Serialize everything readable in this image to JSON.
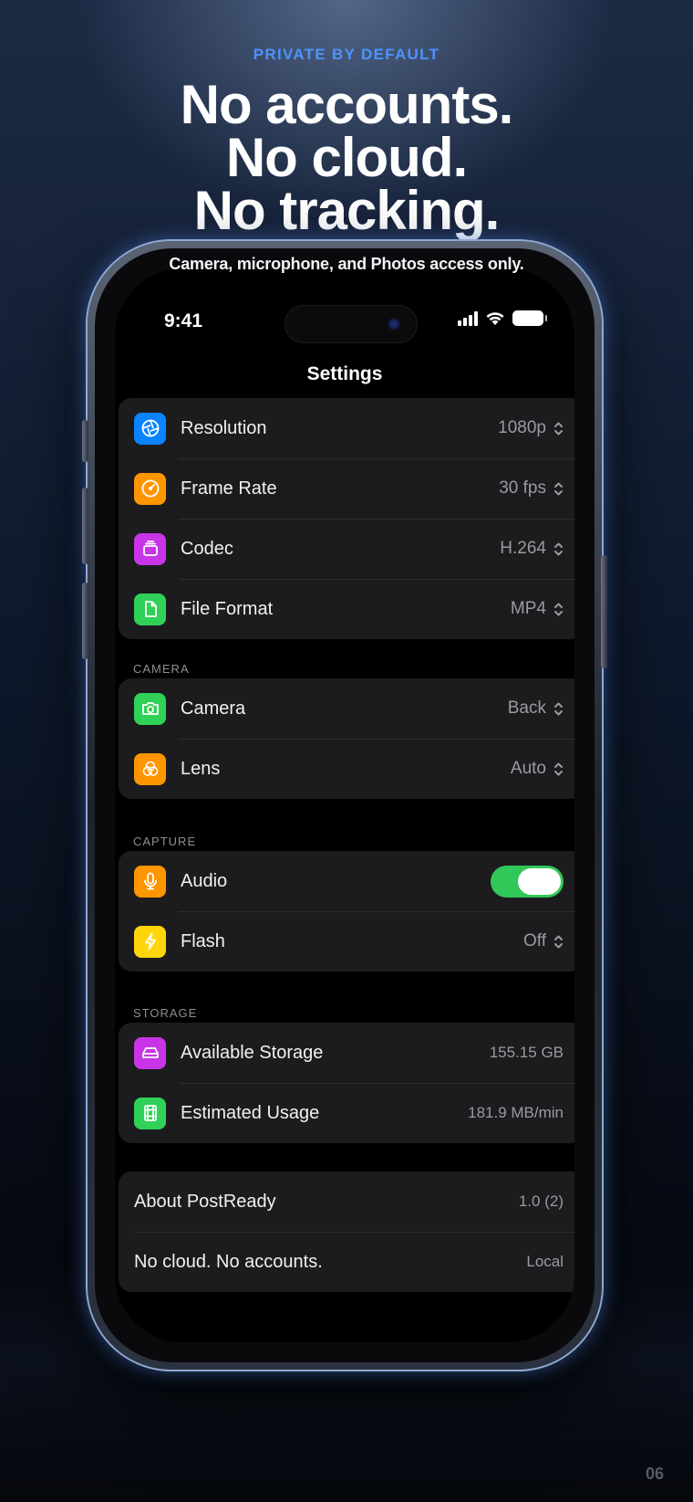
{
  "promo": {
    "kicker": "PRIVATE BY DEFAULT",
    "headline": [
      "No accounts.",
      "No cloud.",
      "No tracking."
    ],
    "subline": "Camera, microphone, and Photos access only.",
    "page_number": "06",
    "accent_color": "#4c94ff"
  },
  "status_bar": {
    "time": "9:41"
  },
  "screen": {
    "title": "Settings"
  },
  "video_group": {
    "rows": [
      {
        "label": "Resolution",
        "value": "1080p",
        "icon": "aperture-icon",
        "color": "#0a84ff"
      },
      {
        "label": "Frame Rate",
        "value": "30 fps",
        "icon": "speedometer-icon",
        "color": "#ff9500"
      },
      {
        "label": "Codec",
        "value": "H.264",
        "icon": "stack-icon",
        "color": "#c835e6"
      },
      {
        "label": "File Format",
        "value": "MP4",
        "icon": "document-icon",
        "color": "#30d158"
      }
    ]
  },
  "camera_group": {
    "header": "CAMERA",
    "rows": [
      {
        "label": "Camera",
        "value": "Back",
        "icon": "camera-rotate-icon",
        "color": "#30d158"
      },
      {
        "label": "Lens",
        "value": "Auto",
        "icon": "lens-circles-icon",
        "color": "#ff9500"
      }
    ]
  },
  "capture_group": {
    "header": "CAPTURE",
    "rows": [
      {
        "label": "Audio",
        "icon": "microphone-icon",
        "color": "#ff9500",
        "toggle_on": true
      },
      {
        "label": "Flash",
        "value": "Off",
        "icon": "bolt-icon",
        "color": "#ffd60a"
      }
    ]
  },
  "storage_group": {
    "header": "STORAGE",
    "rows": [
      {
        "label": "Available Storage",
        "value": "155.15 GB",
        "icon": "drive-icon",
        "color": "#c835e6"
      },
      {
        "label": "Estimated Usage",
        "value": "181.9 MB/min",
        "icon": "film-icon",
        "color": "#30d158"
      }
    ]
  },
  "about_group": {
    "rows": [
      {
        "label": "About PostReady",
        "value": "1.0 (2)"
      },
      {
        "label": "No cloud. No accounts.",
        "value": "Local"
      }
    ]
  }
}
